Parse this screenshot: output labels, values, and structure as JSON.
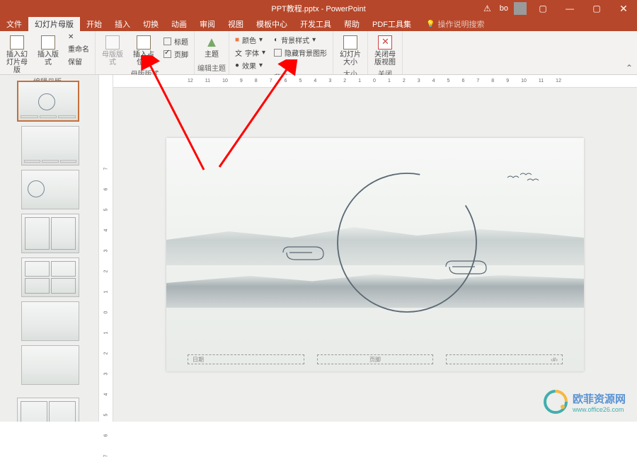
{
  "titlebar": {
    "filename": "PPT教程.pptx - PowerPoint",
    "user": "bo",
    "warn_icon": "⚠"
  },
  "tabs": [
    "文件",
    "幻灯片母版",
    "开始",
    "插入",
    "切换",
    "动画",
    "审阅",
    "视图",
    "模板中心",
    "开发工具",
    "帮助",
    "PDF工具集"
  ],
  "search_placeholder": "操作说明搜索",
  "ribbon": {
    "g1": {
      "label": "编辑母版",
      "insert_slide_master": "插入幻灯片母版",
      "insert_layout": "插入版式",
      "rename": "重命名",
      "preserve": "保留"
    },
    "g2": {
      "label": "母版版式",
      "master_layout": "母版版式",
      "insert_placeholder": "插入占位符",
      "title_chk": "标题",
      "footer_chk": "页脚"
    },
    "g3": {
      "label": "编辑主题",
      "themes": "主题"
    },
    "g4": {
      "label": "背景",
      "colors": "颜色",
      "fonts": "字体",
      "effects": "效果",
      "bg_styles": "背景样式",
      "hide_bg": "隐藏背景图形"
    },
    "g5": {
      "label": "大小",
      "slide_size": "幻灯片大小"
    },
    "g6": {
      "label": "关闭",
      "close_master": "关闭母版视图"
    }
  },
  "hruler_ticks": [
    "12",
    "11",
    "10",
    "9",
    "8",
    "7",
    "6",
    "5",
    "4",
    "3",
    "2",
    "1",
    "0",
    "1",
    "2",
    "3",
    "4",
    "5",
    "6",
    "7",
    "8",
    "9",
    "10",
    "11",
    "12"
  ],
  "vruler_ticks": [
    "7",
    "6",
    "5",
    "4",
    "3",
    "2",
    "1",
    "0",
    "1",
    "2",
    "3",
    "4",
    "5",
    "6",
    "7"
  ],
  "placeholders": {
    "date": "日期",
    "footer": "页脚",
    "num": "‹#›"
  },
  "watermark": {
    "cn": "欧菲资源网",
    "url": "www.office26.com"
  }
}
